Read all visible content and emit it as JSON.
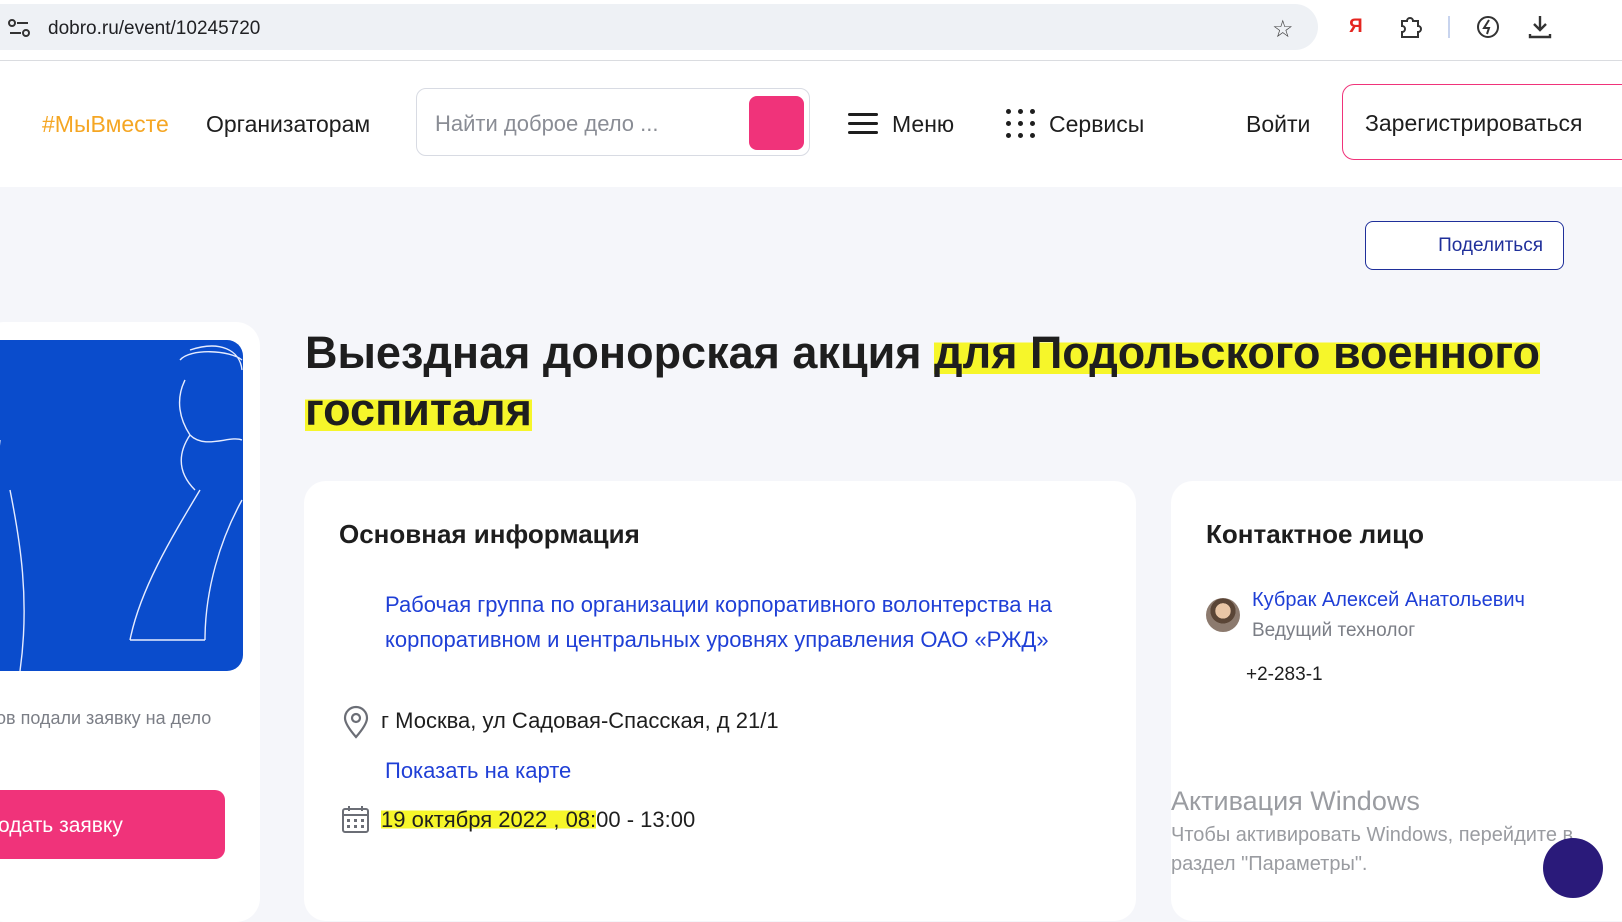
{
  "browser": {
    "url": "dobro.ru/event/10245720",
    "extension_letter": "Я",
    "icons": [
      "site-info-icon",
      "bookmark-star-icon",
      "yandex-icon",
      "extensions-icon",
      "performance-icon",
      "download-icon"
    ]
  },
  "header": {
    "logo": "#МыВместе",
    "organizers": "Организаторам",
    "search_placeholder": "Найти доброе дело ...",
    "menu": "Меню",
    "services": "Сервисы",
    "login": "Войти",
    "register": "Зарегистрироваться"
  },
  "share": "Поделиться",
  "left_panel": {
    "applied_text": "ов подали заявку на дело",
    "apply_button": "одать заявку"
  },
  "event": {
    "title_part1": "Выездная донорская акция ",
    "title_part2": "для Подольского военного госпиталя"
  },
  "info": {
    "heading": "Основная информация",
    "organizer": "Рабочая группа по организации корпоративного волонтерства на корпоративном и центральных уровнях управления ОАО «РЖД»",
    "address": "г Москва, ул Садовая-Спасская, д 21/1",
    "map_link": "Показать на карте",
    "date_highlighted": "19 октября 2022 , 08:",
    "date_rest": "00 - 13:00"
  },
  "contact": {
    "heading": "Контактное лицо",
    "name": "Кубрак Алексей Анатольевич",
    "role": "Ведущий технолог",
    "phone": "+2-283-1"
  },
  "watermark": {
    "title": "Активация Windows",
    "line1": "Чтобы активировать Windows, перейдите в",
    "line2": "раздел \"Параметры\"."
  },
  "colors": {
    "accent_pink": "#f0337a",
    "link_blue": "#1f3fd6",
    "promo_blue": "#0a4ccc",
    "logo_orange": "#f5a623",
    "highlight_yellow": "#f6f62a"
  }
}
